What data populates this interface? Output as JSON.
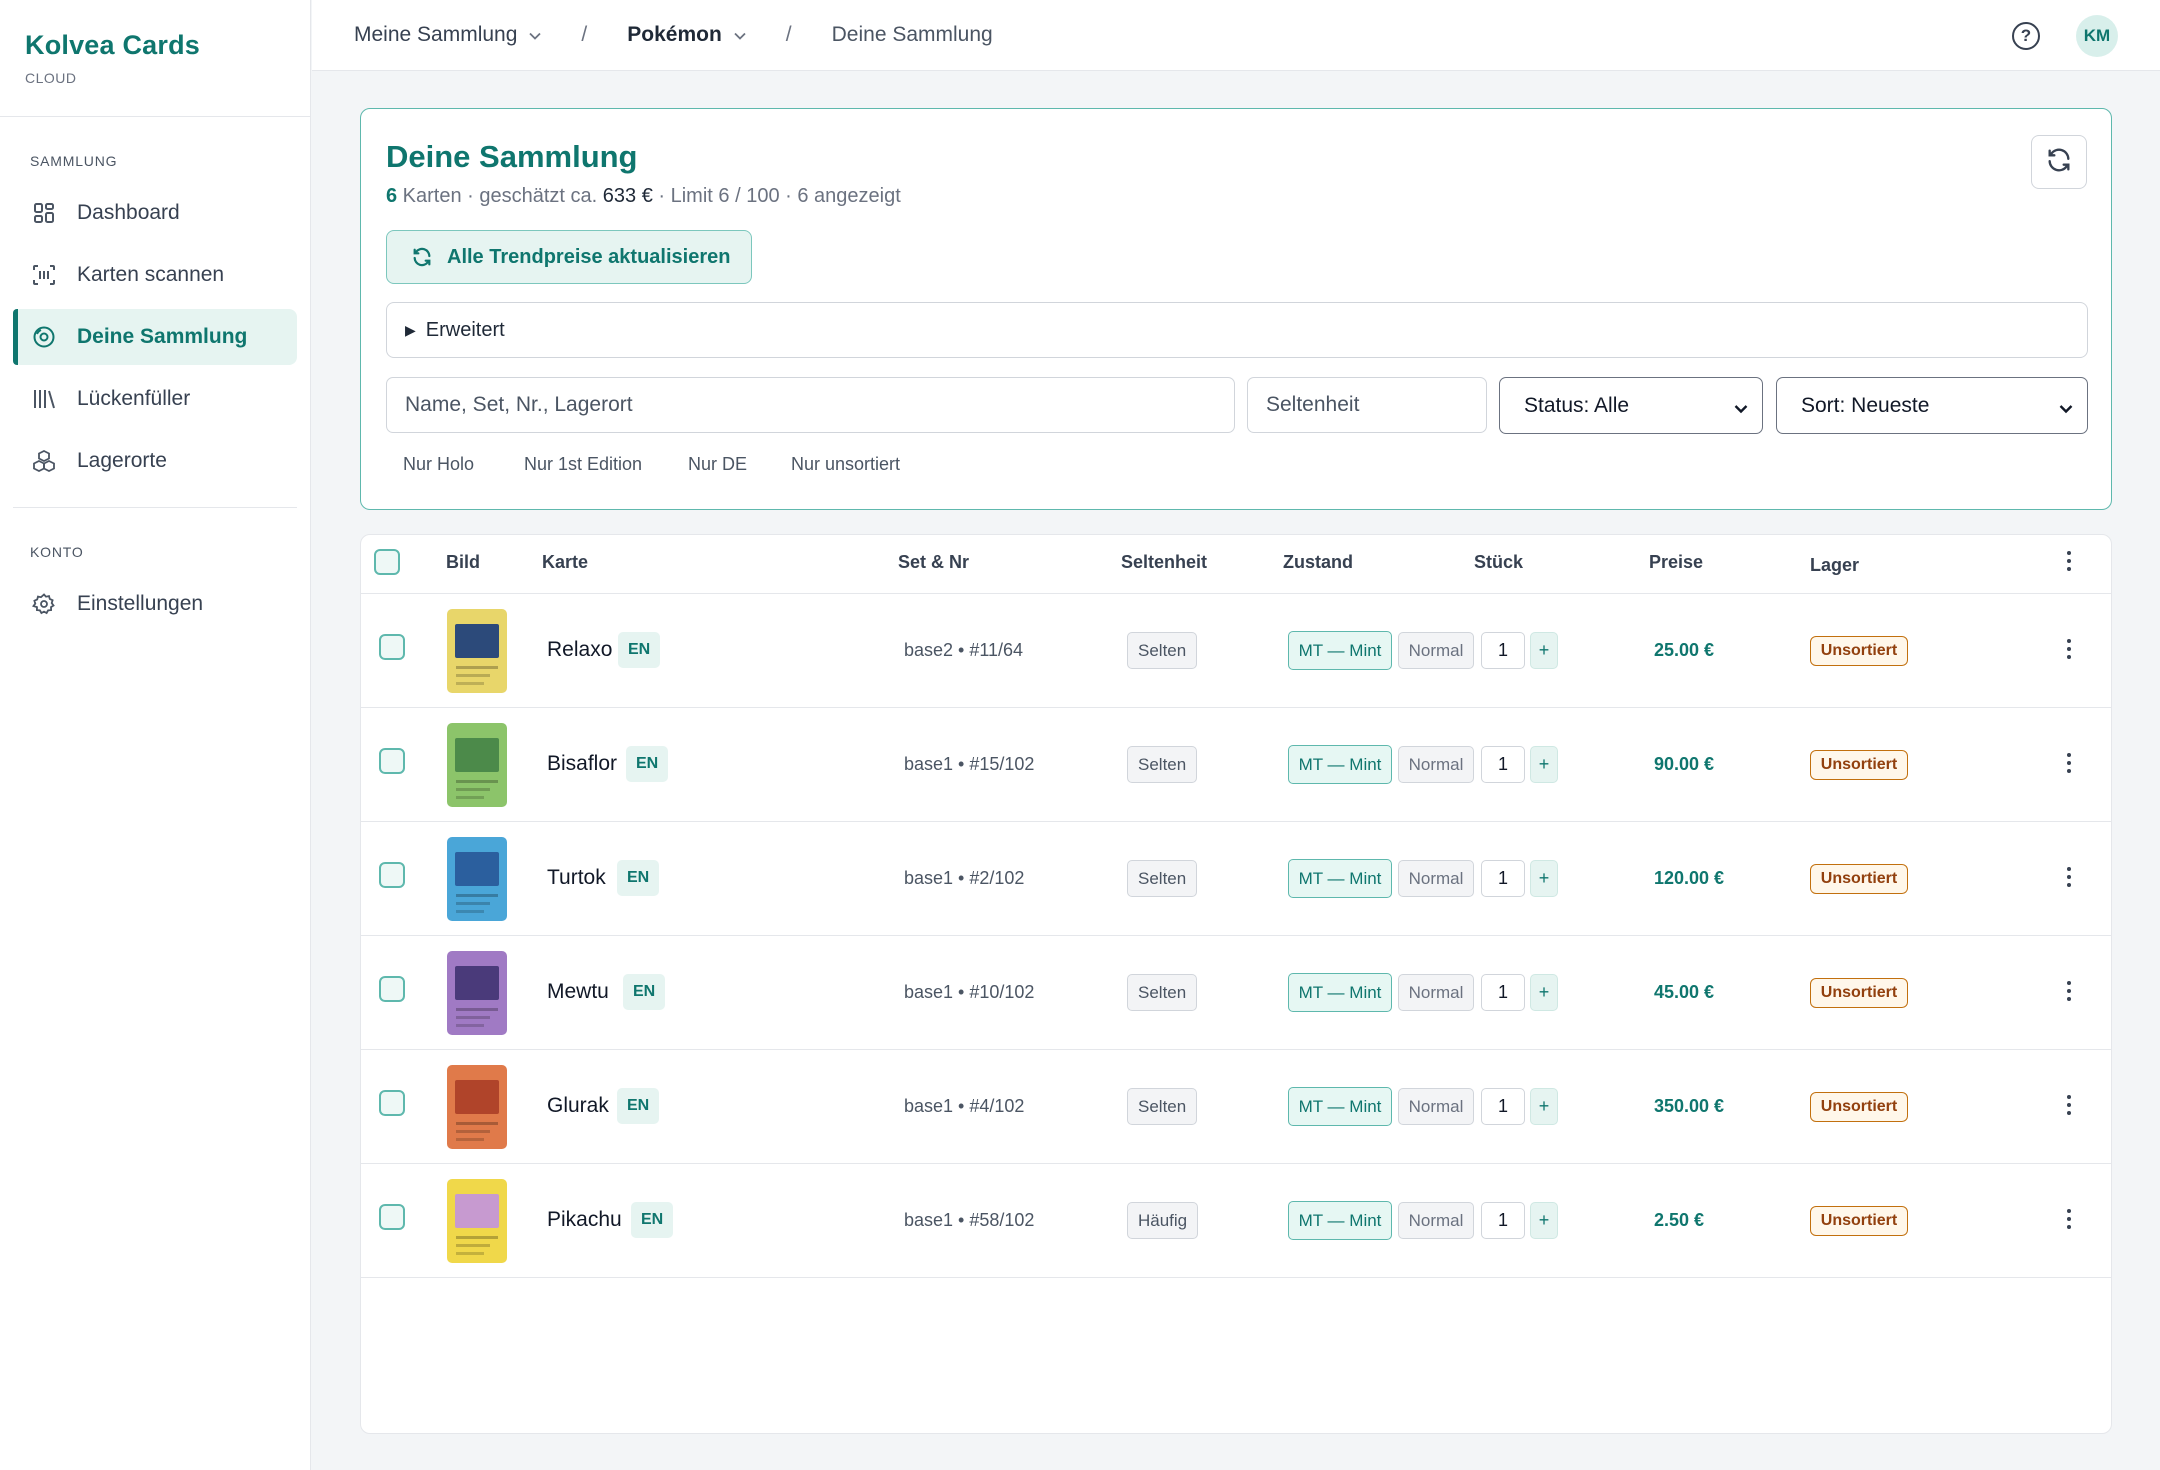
{
  "brand": {
    "title": "Kolvea Cards",
    "subtitle": "CLOUD"
  },
  "sidebar": {
    "sections": [
      {
        "label": "SAMMLUNG",
        "items": [
          {
            "label": "Dashboard",
            "icon": "dashboard-icon"
          },
          {
            "label": "Karten scannen",
            "icon": "scan-icon"
          },
          {
            "label": "Deine Sammlung",
            "icon": "collection-icon",
            "active": true
          },
          {
            "label": "Lückenfüller",
            "icon": "library-icon"
          },
          {
            "label": "Lagerorte",
            "icon": "boxes-icon"
          }
        ]
      },
      {
        "label": "KONTO",
        "items": [
          {
            "label": "Einstellungen",
            "icon": "gear-icon"
          }
        ]
      }
    ]
  },
  "topbar": {
    "breadcrumb": [
      "Meine Sammlung",
      "Pokémon",
      "Deine Sammlung"
    ],
    "separator": "/",
    "avatar_initials": "KM"
  },
  "header": {
    "title": "Deine Sammlung",
    "count": "6",
    "summary_mid": " Karten · geschätzt ca. ",
    "value": "633 €",
    "summary_end": " · Limit 6 / 100 · 6 angezeigt",
    "trend_button": "Alle Trendpreise aktualisieren",
    "advanced_label": "Erweitert",
    "search_placeholder": "Name, Set, Nr., Lagerort",
    "rarity_placeholder": "Seltenheit",
    "status_select": "Status: Alle",
    "sort_select": "Sort: Neueste",
    "quick_filters": [
      "Nur Holo",
      "Nur 1st Edition",
      "Nur DE",
      "Nur unsortiert"
    ]
  },
  "table": {
    "columns": [
      "Bild",
      "Karte",
      "Set & Nr",
      "Seltenheit",
      "Zustand",
      "Stück",
      "Preise",
      "Lager"
    ],
    "rows": [
      {
        "name": "Relaxo",
        "lang": "EN",
        "set": "base2 • #11/64",
        "rarity": "Selten",
        "condition": "MT — Mint",
        "variant": "Normal",
        "qty": "1",
        "price": "25.00 €",
        "location": "Unsortiert",
        "card_color": "#e8d66a",
        "art_color": "#2c4a7a"
      },
      {
        "name": "Bisaflor",
        "lang": "EN",
        "set": "base1 • #15/102",
        "rarity": "Selten",
        "condition": "MT — Mint",
        "variant": "Normal",
        "qty": "1",
        "price": "90.00 €",
        "location": "Unsortiert",
        "card_color": "#8cc46a",
        "art_color": "#4c8a4a"
      },
      {
        "name": "Turtok",
        "lang": "EN",
        "set": "base1 • #2/102",
        "rarity": "Selten",
        "condition": "MT — Mint",
        "variant": "Normal",
        "qty": "1",
        "price": "120.00 €",
        "location": "Unsortiert",
        "card_color": "#4aa6d8",
        "art_color": "#2b5f9e"
      },
      {
        "name": "Mewtu",
        "lang": "EN",
        "set": "base1 • #10/102",
        "rarity": "Selten",
        "condition": "MT — Mint",
        "variant": "Normal",
        "qty": "1",
        "price": "45.00 €",
        "location": "Unsortiert",
        "card_color": "#a07ac4",
        "art_color": "#4a3a7a"
      },
      {
        "name": "Glurak",
        "lang": "EN",
        "set": "base1 • #4/102",
        "rarity": "Selten",
        "condition": "MT — Mint",
        "variant": "Normal",
        "qty": "1",
        "price": "350.00 €",
        "location": "Unsortiert",
        "card_color": "#e07a4a",
        "art_color": "#b0442a"
      },
      {
        "name": "Pikachu",
        "lang": "EN",
        "set": "base1 • #58/102",
        "rarity": "Häufig",
        "condition": "MT — Mint",
        "variant": "Normal",
        "qty": "1",
        "price": "2.50 €",
        "location": "Unsortiert",
        "card_color": "#f0d84a",
        "art_color": "#c79ad0"
      }
    ]
  }
}
